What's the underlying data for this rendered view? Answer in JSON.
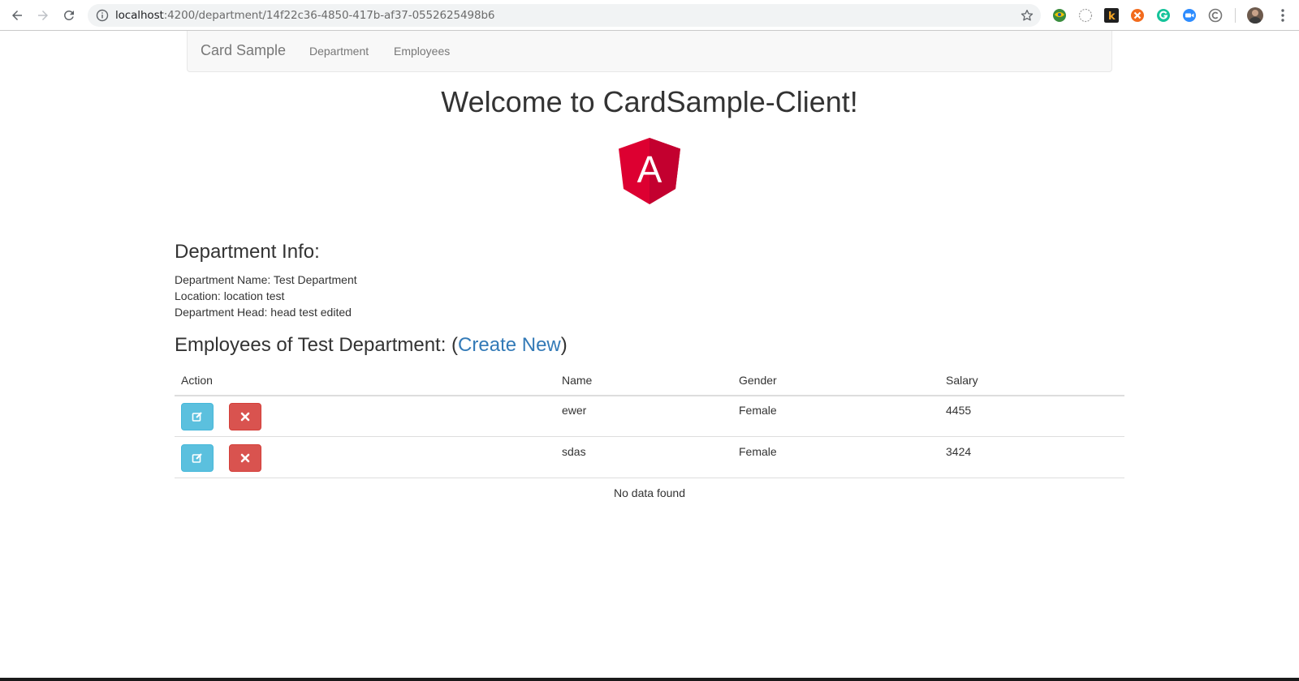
{
  "browser": {
    "url_host": "localhost",
    "url_rest": ":4200/department/14f22c36-4850-417b-af37-0552625498b6",
    "icons": [
      "back-icon",
      "forward-icon",
      "reload-icon",
      "info-icon",
      "star-icon",
      "menu-icon"
    ]
  },
  "navbar": {
    "brand": "Card Sample",
    "links": [
      "Department",
      "Employees"
    ]
  },
  "welcome": "Welcome to CardSample-Client!",
  "logo_letter": "A",
  "department": {
    "heading": "Department Info:",
    "name_line": "Department Name: Test Department",
    "location_line": "Location: location test",
    "head_line": "Department Head: head test edited"
  },
  "employees": {
    "heading_prefix": "Employees of Test Department: (",
    "create_link": "Create New",
    "heading_suffix": ")",
    "columns": [
      "Action",
      "Name",
      "Gender",
      "Salary"
    ],
    "rows": [
      {
        "name": "ewer",
        "gender": "Female",
        "salary": "4455"
      },
      {
        "name": "sdas",
        "gender": "Female",
        "salary": "3424"
      }
    ],
    "empty_text": "No data found"
  },
  "colors": {
    "edit_button": "#5bc0de",
    "delete_button": "#d9534f",
    "link": "#337ab7",
    "angular_red": "#dd0031"
  }
}
